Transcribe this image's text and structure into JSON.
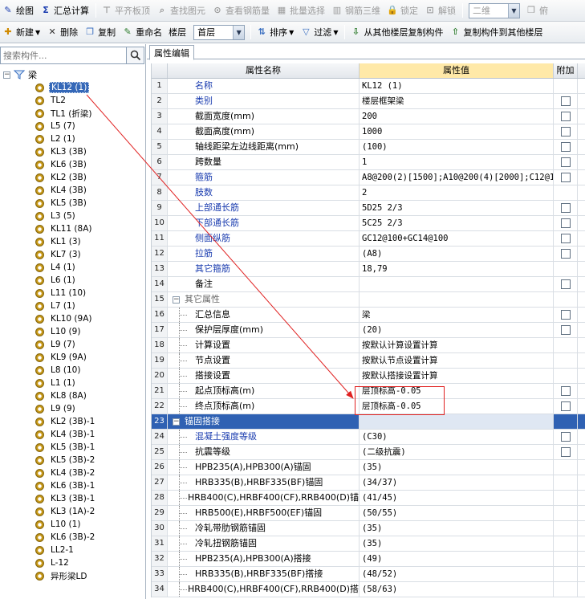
{
  "toolbar1": {
    "items": [
      {
        "label": "绘图",
        "icon": "draw-icon",
        "disabled": false
      },
      {
        "label": "汇总计算",
        "icon": "sigma-icon",
        "disabled": false
      },
      {
        "label": "平齐板顶",
        "icon": "align-top-icon",
        "disabled": true
      },
      {
        "label": "查找图元",
        "icon": "find-icon",
        "disabled": true
      },
      {
        "label": "查看钢筋量",
        "icon": "view-rebar-icon",
        "disabled": true
      },
      {
        "label": "批量选择",
        "icon": "batch-select-icon",
        "disabled": true
      },
      {
        "label": "钢筋三维",
        "icon": "rebar-3d-icon",
        "disabled": true
      },
      {
        "label": "锁定",
        "icon": "lock-icon",
        "disabled": true
      },
      {
        "label": "解锁",
        "icon": "unlock-icon",
        "disabled": true
      }
    ],
    "view_combo": "二维",
    "cut_label": "俯"
  },
  "toolbar2": {
    "new": "新建",
    "delete": "删除",
    "copy": "复制",
    "rename": "重命名",
    "floor_label": "楼层",
    "floor_value": "首层",
    "sort": "排序",
    "filter": "过滤",
    "copy_from": "从其他楼层复制构件",
    "copy_to": "复制构件到其他楼层"
  },
  "search": {
    "placeholder": "搜索构件..."
  },
  "tree": {
    "root": "梁",
    "items": [
      "KL12 (1)",
      "TL2",
      "TL1 (折梁)",
      "L5 (7)",
      "L2 (1)",
      "KL3 (3B)",
      "KL6 (3B)",
      "KL2 (3B)",
      "KL4 (3B)",
      "KL5 (3B)",
      "L3 (5)",
      "KL11 (8A)",
      "KL1 (3)",
      "KL7 (3)",
      "L4 (1)",
      "L6 (1)",
      "L11 (10)",
      "L7 (1)",
      "KL10 (9A)",
      "L10 (9)",
      "L9 (7)",
      "KL9 (9A)",
      "L8 (10)",
      "L1 (1)",
      "KL8 (8A)",
      "L9 (9)",
      "KL2 (3B)-1",
      "KL4 (3B)-1",
      "KL5 (3B)-1",
      "KL5 (3B)-2",
      "KL4 (3B)-2",
      "KL6 (3B)-1",
      "KL3 (3B)-1",
      "KL3 (1A)-2",
      "L10 (1)",
      "KL6 (3B)-2",
      "LL2-1",
      "L-12",
      "异形梁LD"
    ],
    "selected_index": 0
  },
  "tab": "属性编辑",
  "grid": {
    "headers": [
      "属性名称",
      "属性值",
      "附加"
    ],
    "rows": [
      {
        "n": "1",
        "name": "名称",
        "value": "KL12 (1)",
        "style": "blue",
        "cb": false,
        "ind": 0
      },
      {
        "n": "2",
        "name": "类别",
        "value": "楼层框架梁",
        "style": "blue",
        "cb": true,
        "ind": 0
      },
      {
        "n": "3",
        "name": "截面宽度(mm)",
        "value": "200",
        "style": "black",
        "cb": true,
        "ind": 0
      },
      {
        "n": "4",
        "name": "截面高度(mm)",
        "value": "1000",
        "style": "black",
        "cb": true,
        "ind": 0
      },
      {
        "n": "5",
        "name": "轴线距梁左边线距离(mm)",
        "value": "(100)",
        "style": "black",
        "cb": true,
        "ind": 0
      },
      {
        "n": "6",
        "name": "跨数量",
        "value": "1",
        "style": "black",
        "cb": true,
        "ind": 0
      },
      {
        "n": "7",
        "name": "箍筋",
        "value": "A8@200(2)[1500];A10@200(4)[2000];C12@10",
        "style": "blue",
        "cb": true,
        "ind": 0
      },
      {
        "n": "8",
        "name": "肢数",
        "value": "2",
        "style": "blue",
        "cb": false,
        "ind": 0
      },
      {
        "n": "9",
        "name": "上部通长筋",
        "value": "5D25 2/3",
        "style": "blue",
        "cb": true,
        "ind": 0
      },
      {
        "n": "10",
        "name": "下部通长筋",
        "value": "5C25 2/3",
        "style": "blue",
        "cb": true,
        "ind": 0
      },
      {
        "n": "11",
        "name": "侧面纵筋",
        "value": "GC12@100+GC14@100",
        "style": "blue",
        "cb": true,
        "ind": 0
      },
      {
        "n": "12",
        "name": "拉筋",
        "value": "(A8)",
        "style": "blue",
        "cb": true,
        "ind": 0
      },
      {
        "n": "13",
        "name": "其它箍筋",
        "value": "18,79",
        "style": "blue",
        "cb": false,
        "ind": 0
      },
      {
        "n": "14",
        "name": "备注",
        "value": "",
        "style": "black",
        "cb": true,
        "ind": 0
      },
      {
        "n": "15",
        "name": "其它属性",
        "value": "",
        "style": "gray",
        "cb": false,
        "ind": 0,
        "group": true
      },
      {
        "n": "16",
        "name": "汇总信息",
        "value": "梁",
        "style": "black",
        "cb": true,
        "ind": 1
      },
      {
        "n": "17",
        "name": "保护层厚度(mm)",
        "value": "(20)",
        "style": "black",
        "cb": true,
        "ind": 1
      },
      {
        "n": "18",
        "name": "计算设置",
        "value": "按默认计算设置计算",
        "style": "black",
        "cb": false,
        "ind": 1
      },
      {
        "n": "19",
        "name": "节点设置",
        "value": "按默认节点设置计算",
        "style": "black",
        "cb": false,
        "ind": 1
      },
      {
        "n": "20",
        "name": "搭接设置",
        "value": "按默认搭接设置计算",
        "style": "black",
        "cb": false,
        "ind": 1
      },
      {
        "n": "21",
        "name": "起点顶标高(m)",
        "value": "层顶标高-0.05",
        "style": "black",
        "cb": true,
        "ind": 1
      },
      {
        "n": "22",
        "name": "终点顶标高(m)",
        "value": "层顶标高-0.05",
        "style": "black",
        "cb": true,
        "ind": 1
      },
      {
        "n": "23",
        "name": "锚固搭接",
        "value": "",
        "style": "white",
        "cb": false,
        "ind": 0,
        "group": true,
        "hl": true
      },
      {
        "n": "24",
        "name": "混凝土强度等级",
        "value": "(C30)",
        "style": "blue",
        "cb": true,
        "ind": 1
      },
      {
        "n": "25",
        "name": "抗震等级",
        "value": "(二级抗震)",
        "style": "black",
        "cb": true,
        "ind": 1
      },
      {
        "n": "26",
        "name": "HPB235(A),HPB300(A)锚固",
        "value": "(35)",
        "style": "black",
        "cb": false,
        "ind": 1
      },
      {
        "n": "27",
        "name": "HRB335(B),HRBF335(BF)锚固",
        "value": "(34/37)",
        "style": "black",
        "cb": false,
        "ind": 1
      },
      {
        "n": "28",
        "name": "HRB400(C),HRBF400(CF),RRB400(D)锚",
        "value": "(41/45)",
        "style": "black",
        "cb": false,
        "ind": 1
      },
      {
        "n": "29",
        "name": "HRB500(E),HRBF500(EF)锚固",
        "value": "(50/55)",
        "style": "black",
        "cb": false,
        "ind": 1
      },
      {
        "n": "30",
        "name": "冷轧带肋钢筋锚固",
        "value": "(35)",
        "style": "black",
        "cb": false,
        "ind": 1
      },
      {
        "n": "31",
        "name": "冷轧扭钢筋锚固",
        "value": "(35)",
        "style": "black",
        "cb": false,
        "ind": 1
      },
      {
        "n": "32",
        "name": "HPB235(A),HPB300(A)搭接",
        "value": "(49)",
        "style": "black",
        "cb": false,
        "ind": 1
      },
      {
        "n": "33",
        "name": "HRB335(B),HRBF335(BF)搭接",
        "value": "(48/52)",
        "style": "black",
        "cb": false,
        "ind": 1
      },
      {
        "n": "34",
        "name": "HRB400(C),HRBF400(CF),RRB400(D)搭",
        "value": "(58/63)",
        "style": "black",
        "cb": false,
        "ind": 1
      }
    ]
  }
}
